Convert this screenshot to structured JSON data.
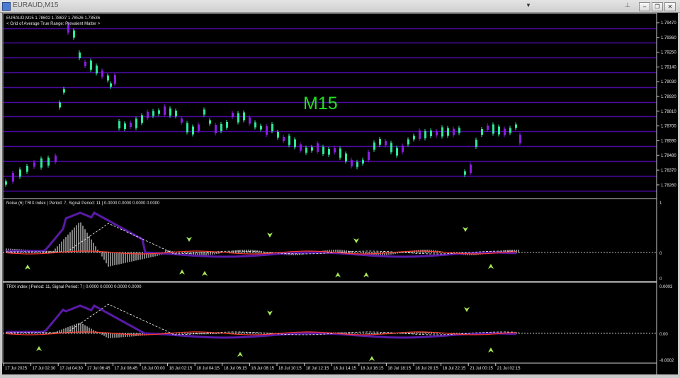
{
  "window": {
    "title": "EURAUD,M15",
    "minimize_glyph": "‒",
    "restore_glyph": "❐",
    "close_glyph": "✕"
  },
  "chart_header": {
    "symbol_line": "EURAUD,M15  1.78602 1.78637 1.78526 1.78536",
    "indicator_line": "< Grid of Average True Range: Prevalent Matter >",
    "timeframe_label": "M15"
  },
  "price_axis": [
    "1.79470",
    "1.79360",
    "1.79250",
    "1.79140",
    "1.79030",
    "1.78920",
    "1.78810",
    "1.78700",
    "1.78590",
    "1.78480",
    "1.78370",
    "1.78260"
  ],
  "time_axis": [
    "17 Jul 2025",
    "17 Jul 02:30",
    "17 Jul 04:30",
    "17 Jul 06:45",
    "17 Jul 08:45",
    "18 Jul 00:00",
    "18 Jul 02:15",
    "18 Jul 04:15",
    "18 Jul 06:15",
    "18 Jul 08:15",
    "18 Jul 10:15",
    "18 Jul 12:15",
    "18 Jul 14:15",
    "18 Jul 16:15",
    "18 Jul 18:15",
    "18 Jul 20:15",
    "18 Jul 22:15",
    "21 Jul 00:15",
    "21 Jul 02:15"
  ],
  "panel1": {
    "label": "Noise (6)  TRIX index | Period: 7, Signal Period: 11 |  0.0000 0.0000 0.0000 0.0000",
    "axis": [
      "1",
      "0",
      "0"
    ]
  },
  "panel2": {
    "label": "TRIX index | Period: 11, Signal Period: 7 |  0.0000 0.0000 0.0000 0.0000",
    "axis": [
      "0.0003",
      "0.00",
      "-0.0002"
    ]
  },
  "colors": {
    "bull": "#2ee89a",
    "bear": "#8a1ee0",
    "grid": "#4b0aa0",
    "trix": "#5a1aa8",
    "signal": "#ffffff",
    "zero_line": "#ff3b2f",
    "arrow": "#a8e85a",
    "timeframe": "#22e022"
  }
}
